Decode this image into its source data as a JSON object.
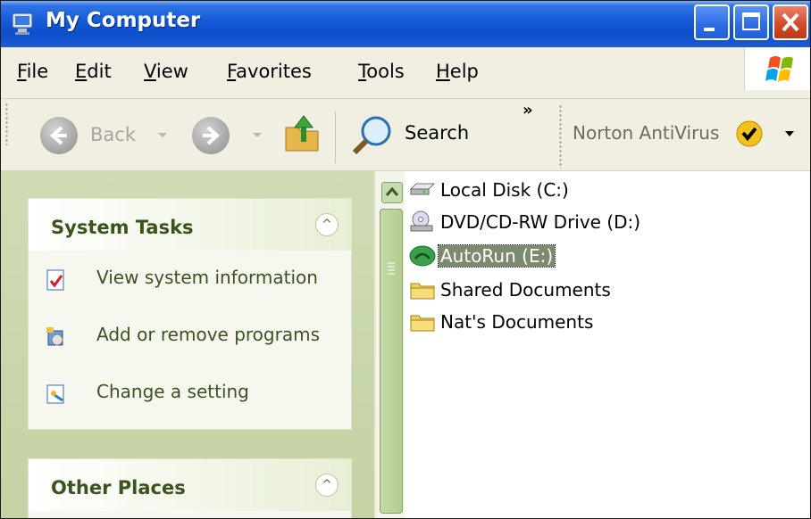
{
  "window": {
    "title": "My Computer",
    "title_icon": "my-computer-icon"
  },
  "menu": {
    "items": [
      "File",
      "Edit",
      "View",
      "Favorites",
      "Tools",
      "Help"
    ]
  },
  "toolbar": {
    "back_label": "Back",
    "search_label": "Search",
    "overflow_label": "»",
    "norton_label": "Norton AntiVirus"
  },
  "task_pane": {
    "system_tasks": {
      "title": "System Tasks",
      "collapse_glyph": "^",
      "items": [
        "View system information",
        "Add or remove programs",
        "Change a setting"
      ]
    },
    "other_places": {
      "title": "Other Places",
      "collapse_glyph": "^"
    }
  },
  "files": [
    {
      "label": "Local Disk (C:)",
      "icon": "hard-disk-icon"
    },
    {
      "label": "DVD/CD-RW Drive (D:)",
      "icon": "cd-drive-icon"
    },
    {
      "label": "AutoRun (E:)",
      "icon": "autorun-drive-icon",
      "selected": true
    },
    {
      "label": "Shared Documents",
      "icon": "folder-icon"
    },
    {
      "label": "Nat's Documents",
      "icon": "folder-icon"
    }
  ],
  "colors": {
    "titlebar": "#0d4fcc",
    "task_pane_bg": "#c4d2a4",
    "task_title": "#3a531c",
    "selection": "#7c8a6e"
  }
}
